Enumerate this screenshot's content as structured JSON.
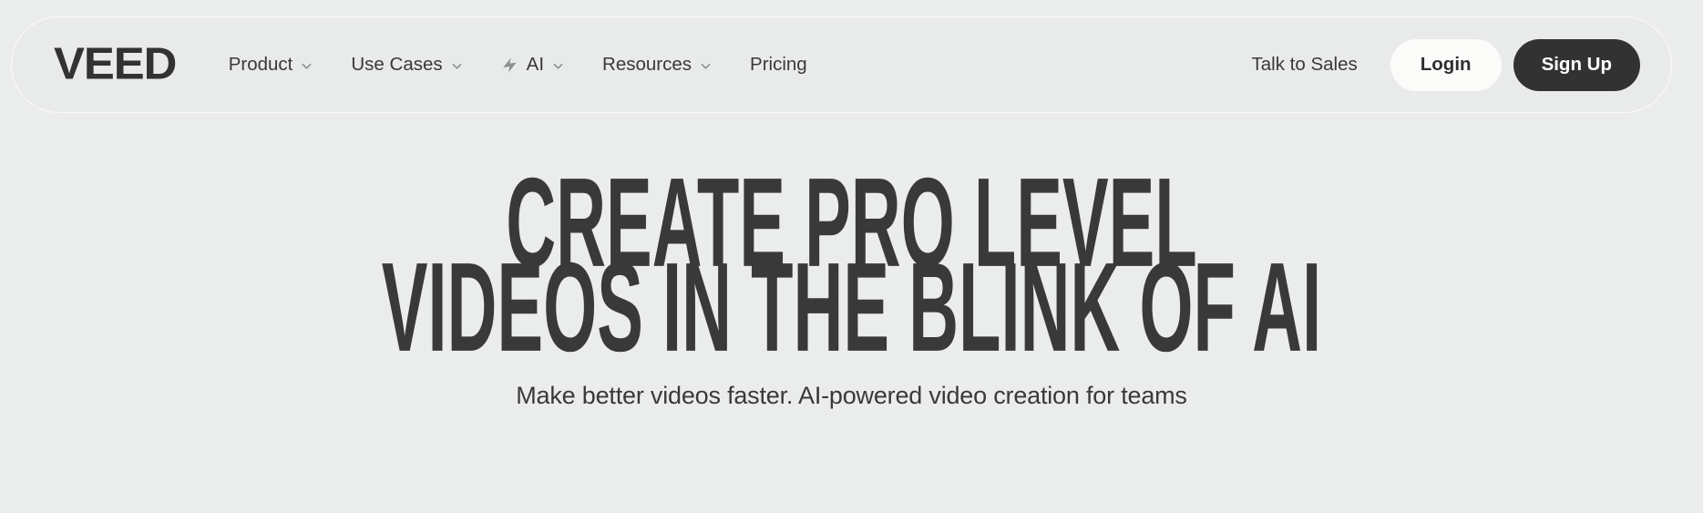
{
  "colors": {
    "page_bg": "#ebecec",
    "navbar_bg": "#e9eaea",
    "text_dark": "#3a3939",
    "button_dark": "#333232",
    "button_light": "#fbfbfa",
    "icon_gray": "#8e9191"
  },
  "navbar": {
    "logo": "VEED",
    "logo_icon": "veed-wordmark",
    "items": [
      {
        "label": "Product",
        "has_chevron": true,
        "has_bolt": false,
        "icon": "chevron-down-icon"
      },
      {
        "label": "Use Cases",
        "has_chevron": true,
        "has_bolt": false,
        "icon": "chevron-down-icon"
      },
      {
        "label": "AI",
        "has_chevron": true,
        "has_bolt": true,
        "icon": "lightning-bolt-icon"
      },
      {
        "label": "Resources",
        "has_chevron": true,
        "has_bolt": false,
        "icon": "chevron-down-icon"
      },
      {
        "label": "Pricing",
        "has_chevron": false,
        "has_bolt": false,
        "icon": ""
      }
    ],
    "talk_to_sales": "Talk to Sales",
    "login": "Login",
    "signup": "Sign Up"
  },
  "hero": {
    "headline_line1": "Create Pro Level",
    "headline_line2": "Videos in the Blink of AI",
    "subtitle": "Make better videos faster. AI-powered video creation for teams"
  }
}
